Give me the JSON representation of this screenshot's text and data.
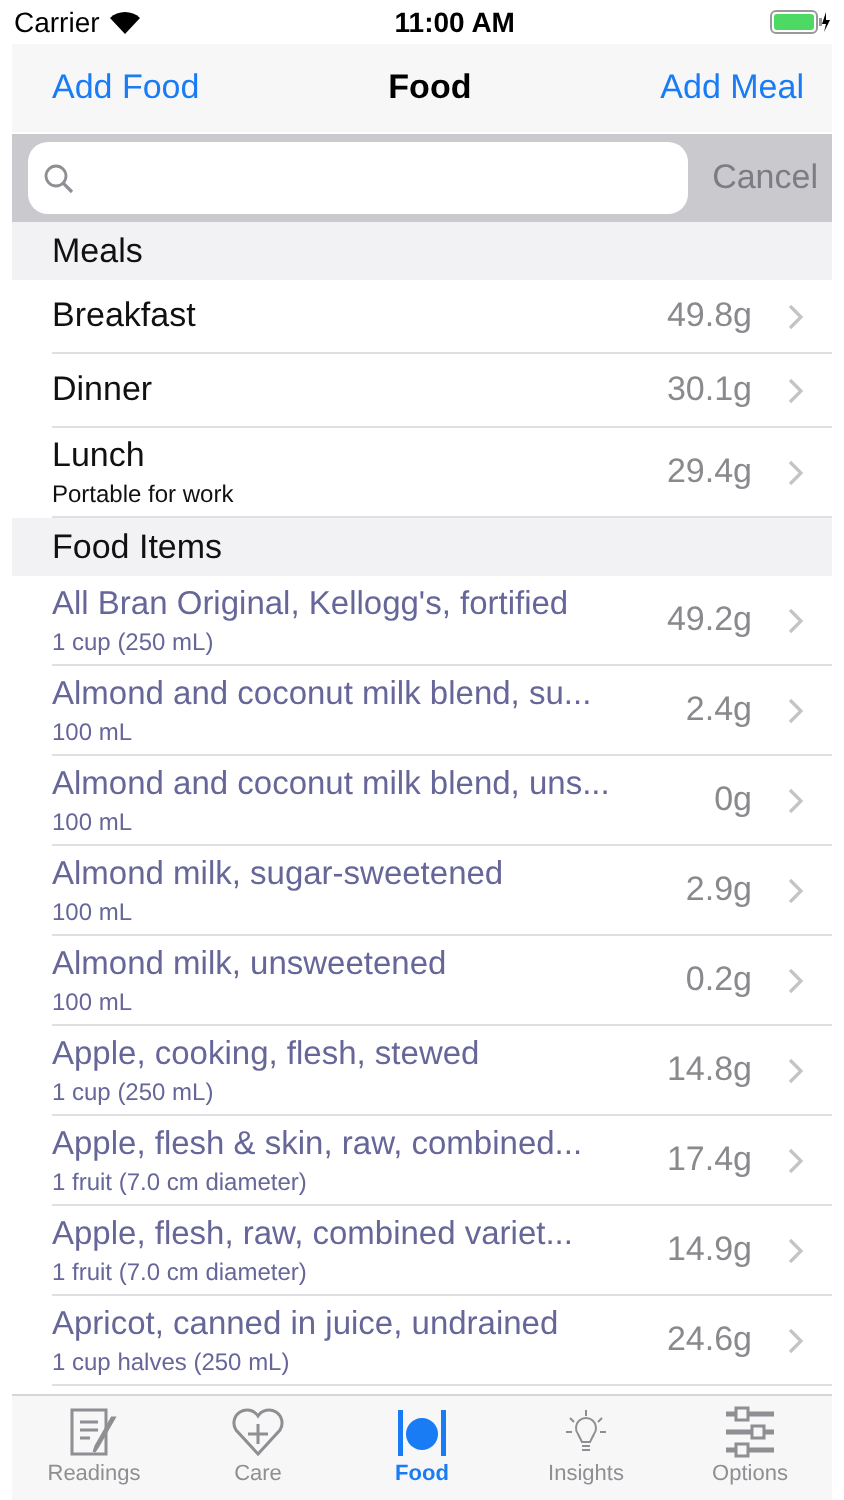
{
  "status_bar": {
    "carrier": "Carrier",
    "time": "11:00 AM"
  },
  "nav_bar": {
    "left_button": "Add Food",
    "title": "Food",
    "right_button": "Add Meal"
  },
  "search": {
    "cancel": "Cancel"
  },
  "sections": [
    {
      "title": "Meals",
      "kind": "meal",
      "rows": [
        {
          "name": "Breakfast",
          "value": "49.8g"
        },
        {
          "name": "Dinner",
          "value": "30.1g"
        },
        {
          "name": "Lunch",
          "detail": "Portable for work",
          "value": "29.4g"
        }
      ]
    },
    {
      "title": "Food Items",
      "kind": "food",
      "rows": [
        {
          "name": "All Bran Original, Kellogg's, fortified",
          "detail": "1 cup (250 mL)",
          "value": "49.2g"
        },
        {
          "name": "Almond and coconut milk blend, su...",
          "detail": "100 mL",
          "value": "2.4g"
        },
        {
          "name": "Almond and coconut milk blend, uns...",
          "detail": "100 mL",
          "value": "0g"
        },
        {
          "name": "Almond milk, sugar-sweetened",
          "detail": "100 mL",
          "value": "2.9g"
        },
        {
          "name": "Almond milk, unsweetened",
          "detail": "100 mL",
          "value": "0.2g"
        },
        {
          "name": "Apple, cooking, flesh, stewed",
          "detail": "1 cup (250 mL)",
          "value": "14.8g"
        },
        {
          "name": "Apple, flesh & skin, raw, combined...",
          "detail": "1 fruit (7.0 cm diameter)",
          "value": "17.4g"
        },
        {
          "name": "Apple, flesh, raw, combined variet...",
          "detail": "1 fruit (7.0 cm diameter)",
          "value": "14.9g"
        },
        {
          "name": "Apricot, canned in juice, undrained",
          "detail": "1 cup halves (250 mL)",
          "value": "24.6g"
        }
      ]
    }
  ],
  "tab_bar": [
    {
      "label": "Readings",
      "kind": "readings",
      "selected": false
    },
    {
      "label": "Care",
      "kind": "care",
      "selected": false
    },
    {
      "label": "Food",
      "kind": "food",
      "selected": true
    },
    {
      "label": "Insights",
      "kind": "insights",
      "selected": false
    },
    {
      "label": "Options",
      "kind": "options",
      "selected": false
    }
  ]
}
